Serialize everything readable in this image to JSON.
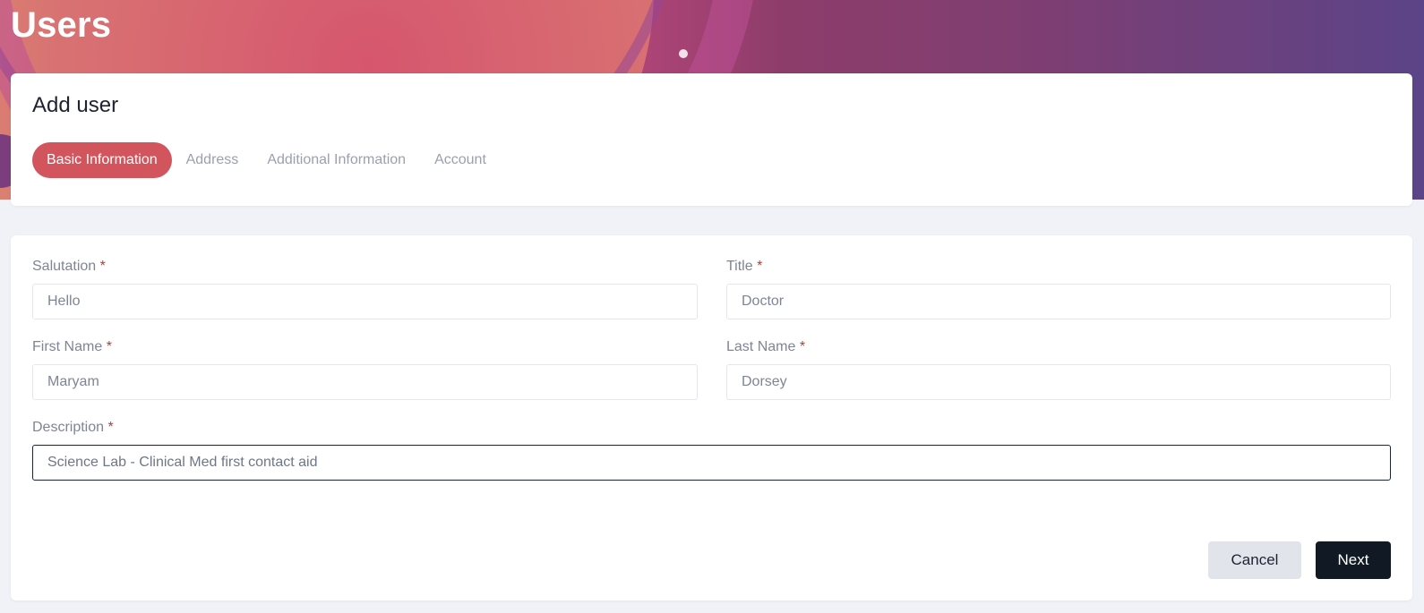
{
  "header": {
    "title": "Users"
  },
  "card": {
    "title": "Add user"
  },
  "tabs": [
    {
      "label": "Basic Information",
      "active": true
    },
    {
      "label": "Address",
      "active": false
    },
    {
      "label": "Additional Information",
      "active": false
    },
    {
      "label": "Account",
      "active": false
    }
  ],
  "form": {
    "required_marker": "*",
    "salutation": {
      "label": "Salutation",
      "value": "Hello"
    },
    "title": {
      "label": "Title",
      "value": "Doctor"
    },
    "first_name": {
      "label": "First Name",
      "value": "Maryam"
    },
    "last_name": {
      "label": "Last Name",
      "value": "Dorsey"
    },
    "description": {
      "label": "Description",
      "value": "Science Lab - Clinical Med first contact aid"
    }
  },
  "buttons": {
    "cancel": "Cancel",
    "next": "Next"
  },
  "colors": {
    "accent": "#d2545d",
    "primary_button": "#111a24",
    "secondary_button": "#e1e4ea",
    "required": "#c0392b"
  }
}
